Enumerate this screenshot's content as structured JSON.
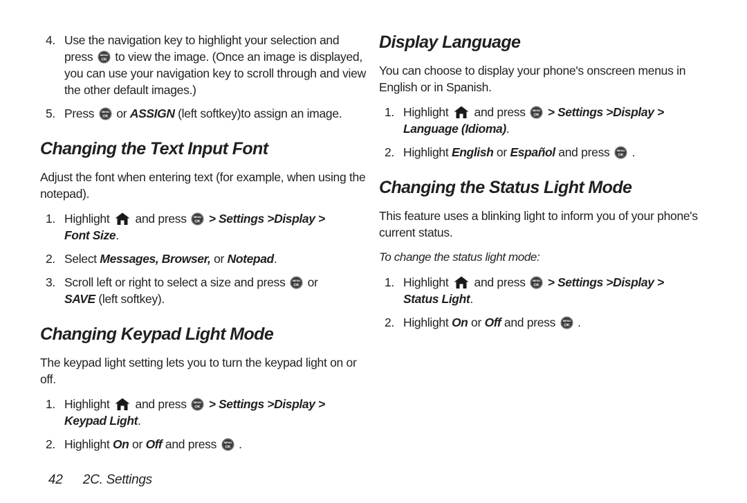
{
  "page": {
    "number": "42",
    "chapter": "2C. Settings"
  },
  "icons": {
    "menu_ok": "menu-ok-key-icon",
    "home": "home-key-icon",
    "menu_ok_top_label": "MENU",
    "menu_ok_bottom_label": "OK"
  },
  "left_column": {
    "continued_steps": [
      {
        "num": "4.",
        "parts": [
          {
            "t": "Use the navigation key to highlight your selection and press ",
            "s": "plain"
          },
          {
            "t": "menu-ok-icon",
            "s": "icon-menuok"
          },
          {
            "t": " to view the image. (Once an image is displayed, you can use your navigation key to scroll through and view the other default images.)",
            "s": "plain"
          }
        ]
      },
      {
        "num": "5.",
        "parts": [
          {
            "t": "Press ",
            "s": "plain"
          },
          {
            "t": "menu-ok-icon",
            "s": "icon-menuok"
          },
          {
            "t": " or ",
            "s": "plain"
          },
          {
            "t": "ASSIGN",
            "s": "bi"
          },
          {
            "t": " (left softkey)to assign an image.",
            "s": "plain"
          }
        ]
      }
    ],
    "sections": [
      {
        "heading": "Changing the Text Input Font",
        "intro": "Adjust the font when entering text (for example, when using the notepad).",
        "steps": [
          {
            "num": "1.",
            "parts": [
              {
                "t": "Highlight ",
                "s": "plain"
              },
              {
                "t": "home-icon",
                "s": "icon-home"
              },
              {
                "t": " and press ",
                "s": "plain"
              },
              {
                "t": "menu-ok-icon",
                "s": "icon-menuok"
              },
              {
                "t": " > Settings >Display >",
                "s": "bi"
              },
              {
                "t": "\n",
                "s": "br"
              },
              {
                "t": "Font Size",
                "s": "bi"
              },
              {
                "t": ".",
                "s": "plain"
              }
            ]
          },
          {
            "num": "2.",
            "parts": [
              {
                "t": "Select ",
                "s": "plain"
              },
              {
                "t": "Messages, Browser,",
                "s": "bi"
              },
              {
                "t": " or ",
                "s": "plain"
              },
              {
                "t": "Notepad",
                "s": "bi"
              },
              {
                "t": ".",
                "s": "plain"
              }
            ]
          },
          {
            "num": "3.",
            "parts": [
              {
                "t": "Scroll left or right to select a size and press ",
                "s": "plain"
              },
              {
                "t": "menu-ok-icon",
                "s": "icon-menuok"
              },
              {
                "t": " or",
                "s": "plain"
              },
              {
                "t": "\n",
                "s": "br"
              },
              {
                "t": "SAVE",
                "s": "bi"
              },
              {
                "t": " (left softkey).",
                "s": "plain"
              }
            ]
          }
        ]
      },
      {
        "heading": "Changing Keypad Light Mode",
        "intro": "The keypad light setting lets you to turn the keypad light on or off.",
        "steps": [
          {
            "num": "1.",
            "parts": [
              {
                "t": "Highlight ",
                "s": "plain"
              },
              {
                "t": "home-icon",
                "s": "icon-home"
              },
              {
                "t": " and press ",
                "s": "plain"
              },
              {
                "t": "menu-ok-icon",
                "s": "icon-menuok"
              },
              {
                "t": " > Settings >Display >",
                "s": "bi"
              },
              {
                "t": "\n",
                "s": "br"
              },
              {
                "t": "Keypad Light",
                "s": "bi"
              },
              {
                "t": ".",
                "s": "plain"
              }
            ]
          },
          {
            "num": "2.",
            "parts": [
              {
                "t": "Highlight ",
                "s": "plain"
              },
              {
                "t": "On",
                "s": "bi"
              },
              {
                "t": " or ",
                "s": "plain"
              },
              {
                "t": "Off",
                "s": "bi"
              },
              {
                "t": " and press ",
                "s": "plain"
              },
              {
                "t": "menu-ok-icon",
                "s": "icon-menuok"
              },
              {
                "t": " .",
                "s": "plain"
              }
            ]
          }
        ]
      }
    ]
  },
  "right_column": {
    "sections": [
      {
        "heading": "Display Language",
        "intro": "You can choose to display your phone's onscreen menus in English or in Spanish.",
        "steps": [
          {
            "num": "1.",
            "parts": [
              {
                "t": "Highlight ",
                "s": "plain"
              },
              {
                "t": "home-icon",
                "s": "icon-home"
              },
              {
                "t": " and press ",
                "s": "plain"
              },
              {
                "t": "menu-ok-icon",
                "s": "icon-menuok"
              },
              {
                "t": " > Settings >Display >",
                "s": "bi"
              },
              {
                "t": "\n",
                "s": "br"
              },
              {
                "t": "Language (Idioma)",
                "s": "bi"
              },
              {
                "t": ".",
                "s": "plain"
              }
            ]
          },
          {
            "num": "2.",
            "parts": [
              {
                "t": "Highlight ",
                "s": "plain"
              },
              {
                "t": "English",
                "s": "bi"
              },
              {
                "t": " or ",
                "s": "plain"
              },
              {
                "t": "Español",
                "s": "bi"
              },
              {
                "t": " and press ",
                "s": "plain"
              },
              {
                "t": "menu-ok-icon",
                "s": "icon-menuok"
              },
              {
                "t": " .",
                "s": "plain"
              }
            ]
          }
        ]
      },
      {
        "heading": "Changing the Status Light Mode",
        "intro": "This feature uses a blinking light to inform you of your phone's current status.",
        "subhead": "To change the status light mode:",
        "steps": [
          {
            "num": "1.",
            "parts": [
              {
                "t": "Highlight ",
                "s": "plain"
              },
              {
                "t": "home-icon",
                "s": "icon-home"
              },
              {
                "t": " and press ",
                "s": "plain"
              },
              {
                "t": "menu-ok-icon",
                "s": "icon-menuok"
              },
              {
                "t": " > Settings >Display >",
                "s": "bi"
              },
              {
                "t": "\n",
                "s": "br"
              },
              {
                "t": "Status Light",
                "s": "bi"
              },
              {
                "t": ".",
                "s": "plain"
              }
            ]
          },
          {
            "num": "2.",
            "parts": [
              {
                "t": "Highlight ",
                "s": "plain"
              },
              {
                "t": "On",
                "s": "bi"
              },
              {
                "t": " or ",
                "s": "plain"
              },
              {
                "t": "Off",
                "s": "bi"
              },
              {
                "t": " and press ",
                "s": "plain"
              },
              {
                "t": "menu-ok-icon",
                "s": "icon-menuok"
              },
              {
                "t": " .",
                "s": "plain"
              }
            ]
          }
        ]
      }
    ]
  }
}
